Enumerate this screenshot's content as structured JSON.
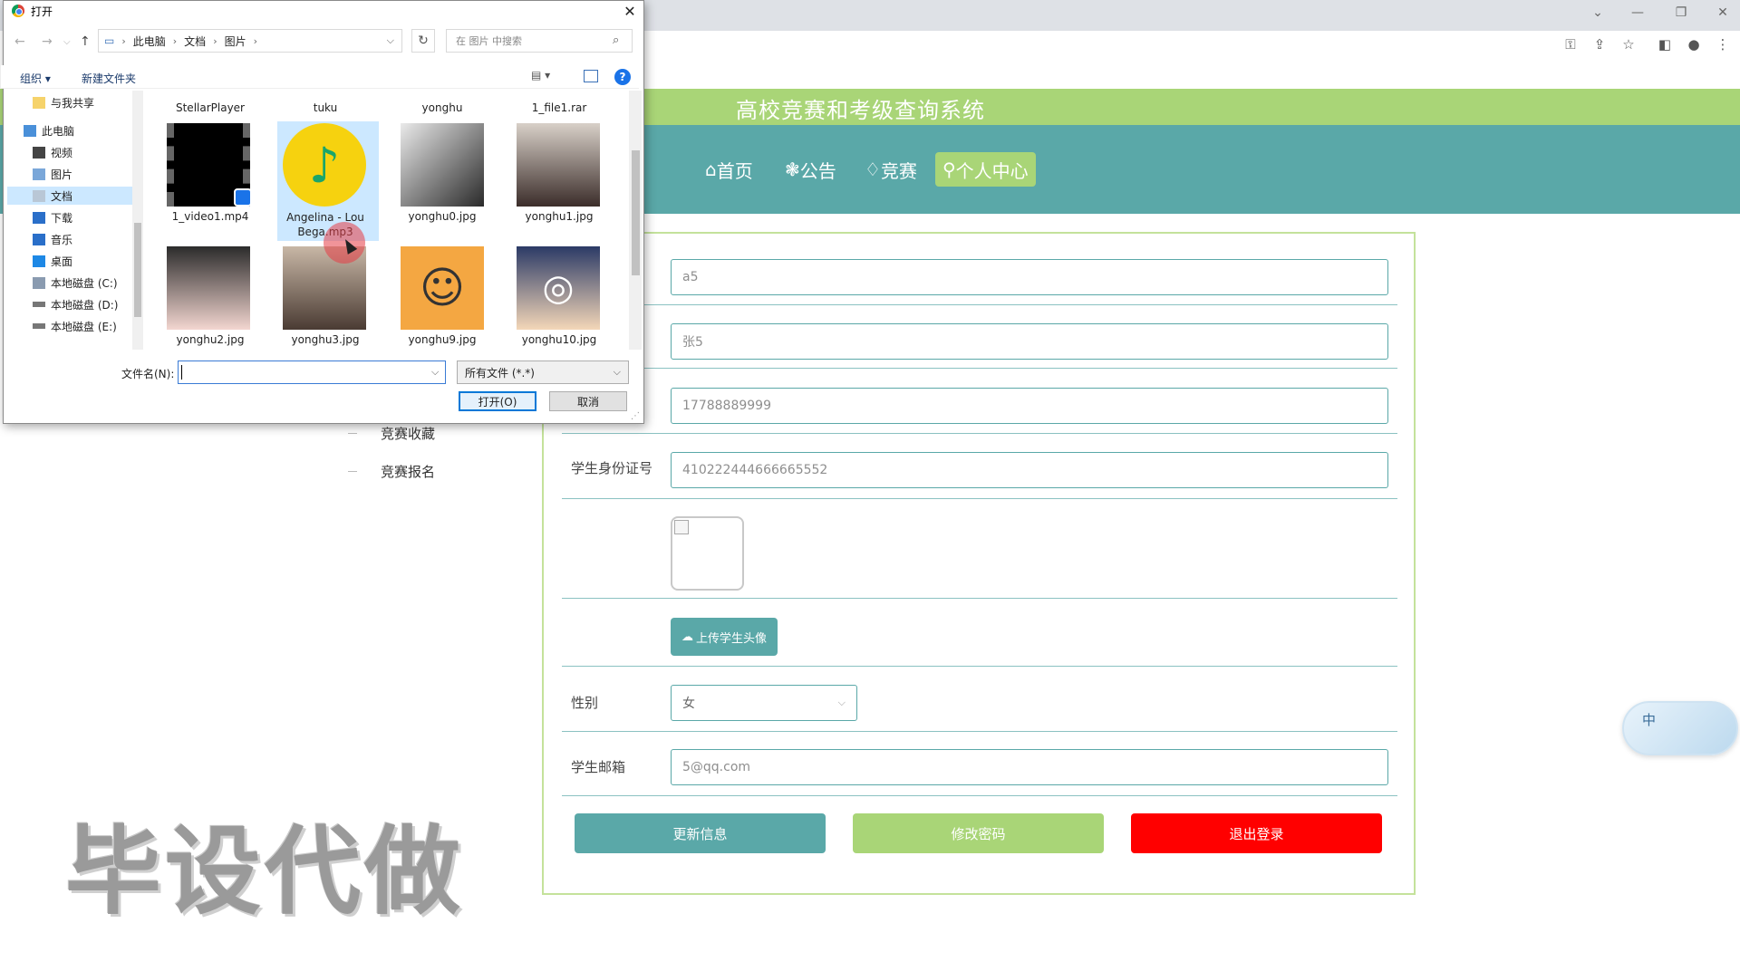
{
  "site": {
    "title": "高校竞赛和考级查询系统",
    "nav": [
      {
        "icon": "⌂",
        "label": "首页"
      },
      {
        "icon": "❃",
        "label": "公告"
      },
      {
        "icon": "♢",
        "label": "竞赛"
      },
      {
        "icon": "⚲",
        "label": "个人中心"
      }
    ],
    "active_nav_index": 3,
    "colors": {
      "accent_green": "#a9d577",
      "teal": "#5aa8a8",
      "danger": "#ff0000"
    }
  },
  "sidebar": {
    "items": [
      "竞赛收藏",
      "竞赛报名"
    ]
  },
  "form": {
    "username_value": "a5",
    "name_value": "张5",
    "phone_value": "17788889999",
    "idcard_label": "学生身份证号",
    "idcard_value": "410222444666665552",
    "upload_label": "上传学生头像",
    "gender_label": "性别",
    "gender_value": "女",
    "email_label": "学生邮箱",
    "email_value": "5@qq.com",
    "buttons": {
      "update": "更新信息",
      "password": "修改密码",
      "logout": "退出登录"
    }
  },
  "watermark": "毕设代做",
  "ime": {
    "char": "中"
  },
  "dialog": {
    "title": "打开",
    "breadcrumb": [
      "此电脑",
      "文档",
      "图片"
    ],
    "search_placeholder": "在 图片 中搜索",
    "organize": "组织 ▾",
    "new_folder": "新建文件夹",
    "help": "?",
    "nav_pane": [
      {
        "label": "与我共享",
        "icon": "folder-icon"
      },
      {
        "label": "此电脑",
        "icon": "pc-icon"
      },
      {
        "label": "视频",
        "icon": "video-folder-icon"
      },
      {
        "label": "图片",
        "icon": "picture-folder-icon"
      },
      {
        "label": "文档",
        "icon": "document-folder-icon"
      },
      {
        "label": "下载",
        "icon": "download-icon"
      },
      {
        "label": "音乐",
        "icon": "music-icon"
      },
      {
        "label": "桌面",
        "icon": "desktop-icon"
      },
      {
        "label": "本地磁盘 (C:)",
        "icon": "drive-c-icon"
      },
      {
        "label": "本地磁盘 (D:)",
        "icon": "drive-icon"
      },
      {
        "label": "本地磁盘 (E:)",
        "icon": "drive-icon"
      }
    ],
    "files_top_row": [
      "StellarPlayer",
      "tuku",
      "yonghu",
      "1_file1.rar"
    ],
    "files": [
      {
        "name": "1_video1.mp4",
        "kind": "video"
      },
      {
        "name": "Angelina - Lou Bega.mp3",
        "kind": "music",
        "selected": true
      },
      {
        "name": "yonghu0.jpg",
        "kind": "photo"
      },
      {
        "name": "yonghu1.jpg",
        "kind": "photo"
      },
      {
        "name": "yonghu2.jpg",
        "kind": "photo"
      },
      {
        "name": "yonghu3.jpg",
        "kind": "photo"
      },
      {
        "name": "yonghu9.jpg",
        "kind": "cartoon"
      },
      {
        "name": "yonghu10.jpg",
        "kind": "cartoon"
      }
    ],
    "filename_label": "文件名(N):",
    "filename_value": "",
    "filetype": "所有文件 (*.*)",
    "open_button": "打开(O)",
    "cancel_button": "取消"
  }
}
